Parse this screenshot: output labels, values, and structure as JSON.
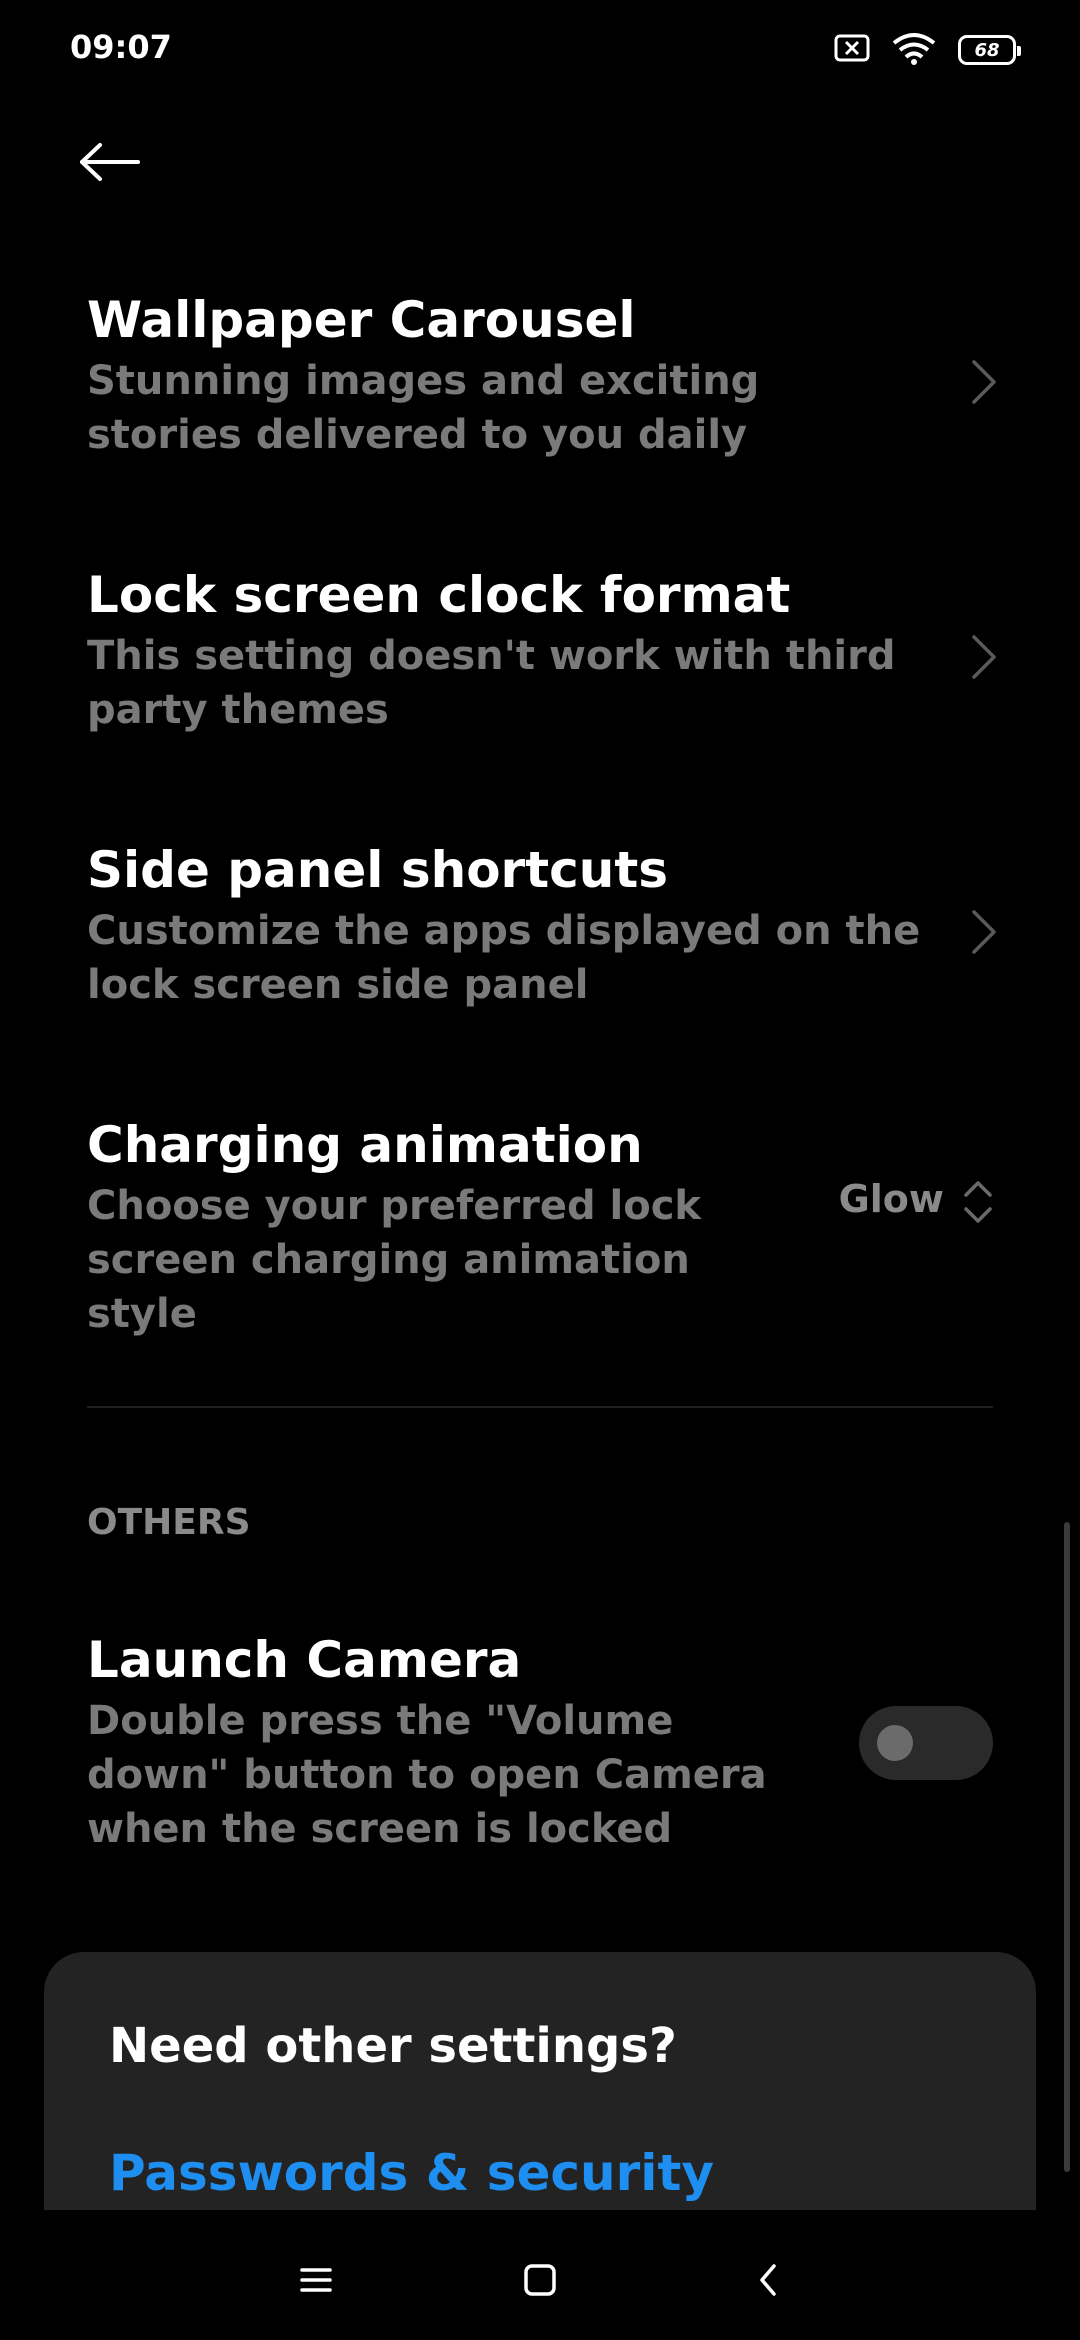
{
  "status_bar": {
    "time": "09:07",
    "battery": "68",
    "icons": [
      "notification-blocked-icon",
      "wifi-icon",
      "battery-icon"
    ]
  },
  "header": {
    "back_icon": "back-arrow-icon"
  },
  "items": [
    {
      "title": "Wallpaper Carousel",
      "subtitle": "Stunning images and exciting stories delivered to you daily"
    },
    {
      "title": "Lock screen clock format",
      "subtitle": "This setting doesn't work with third party themes"
    },
    {
      "title": "Side panel shortcuts",
      "subtitle": "Customize the apps displayed on the lock screen side panel"
    },
    {
      "title": "Charging animation",
      "subtitle": "Choose your preferred lock screen charging animation style",
      "value": "Glow"
    }
  ],
  "others": {
    "header": "OTHERS",
    "launch_camera": {
      "title": "Launch Camera",
      "subtitle": "Double press the \"Volume down\" button to open Camera when the screen is locked",
      "enabled": false
    }
  },
  "card": {
    "title": "Need other settings?",
    "link": "Passwords & security"
  },
  "colors": {
    "background": "#000000",
    "subtitle": "#7a7a7a",
    "link": "#1e8ef0",
    "card": "#232323"
  }
}
